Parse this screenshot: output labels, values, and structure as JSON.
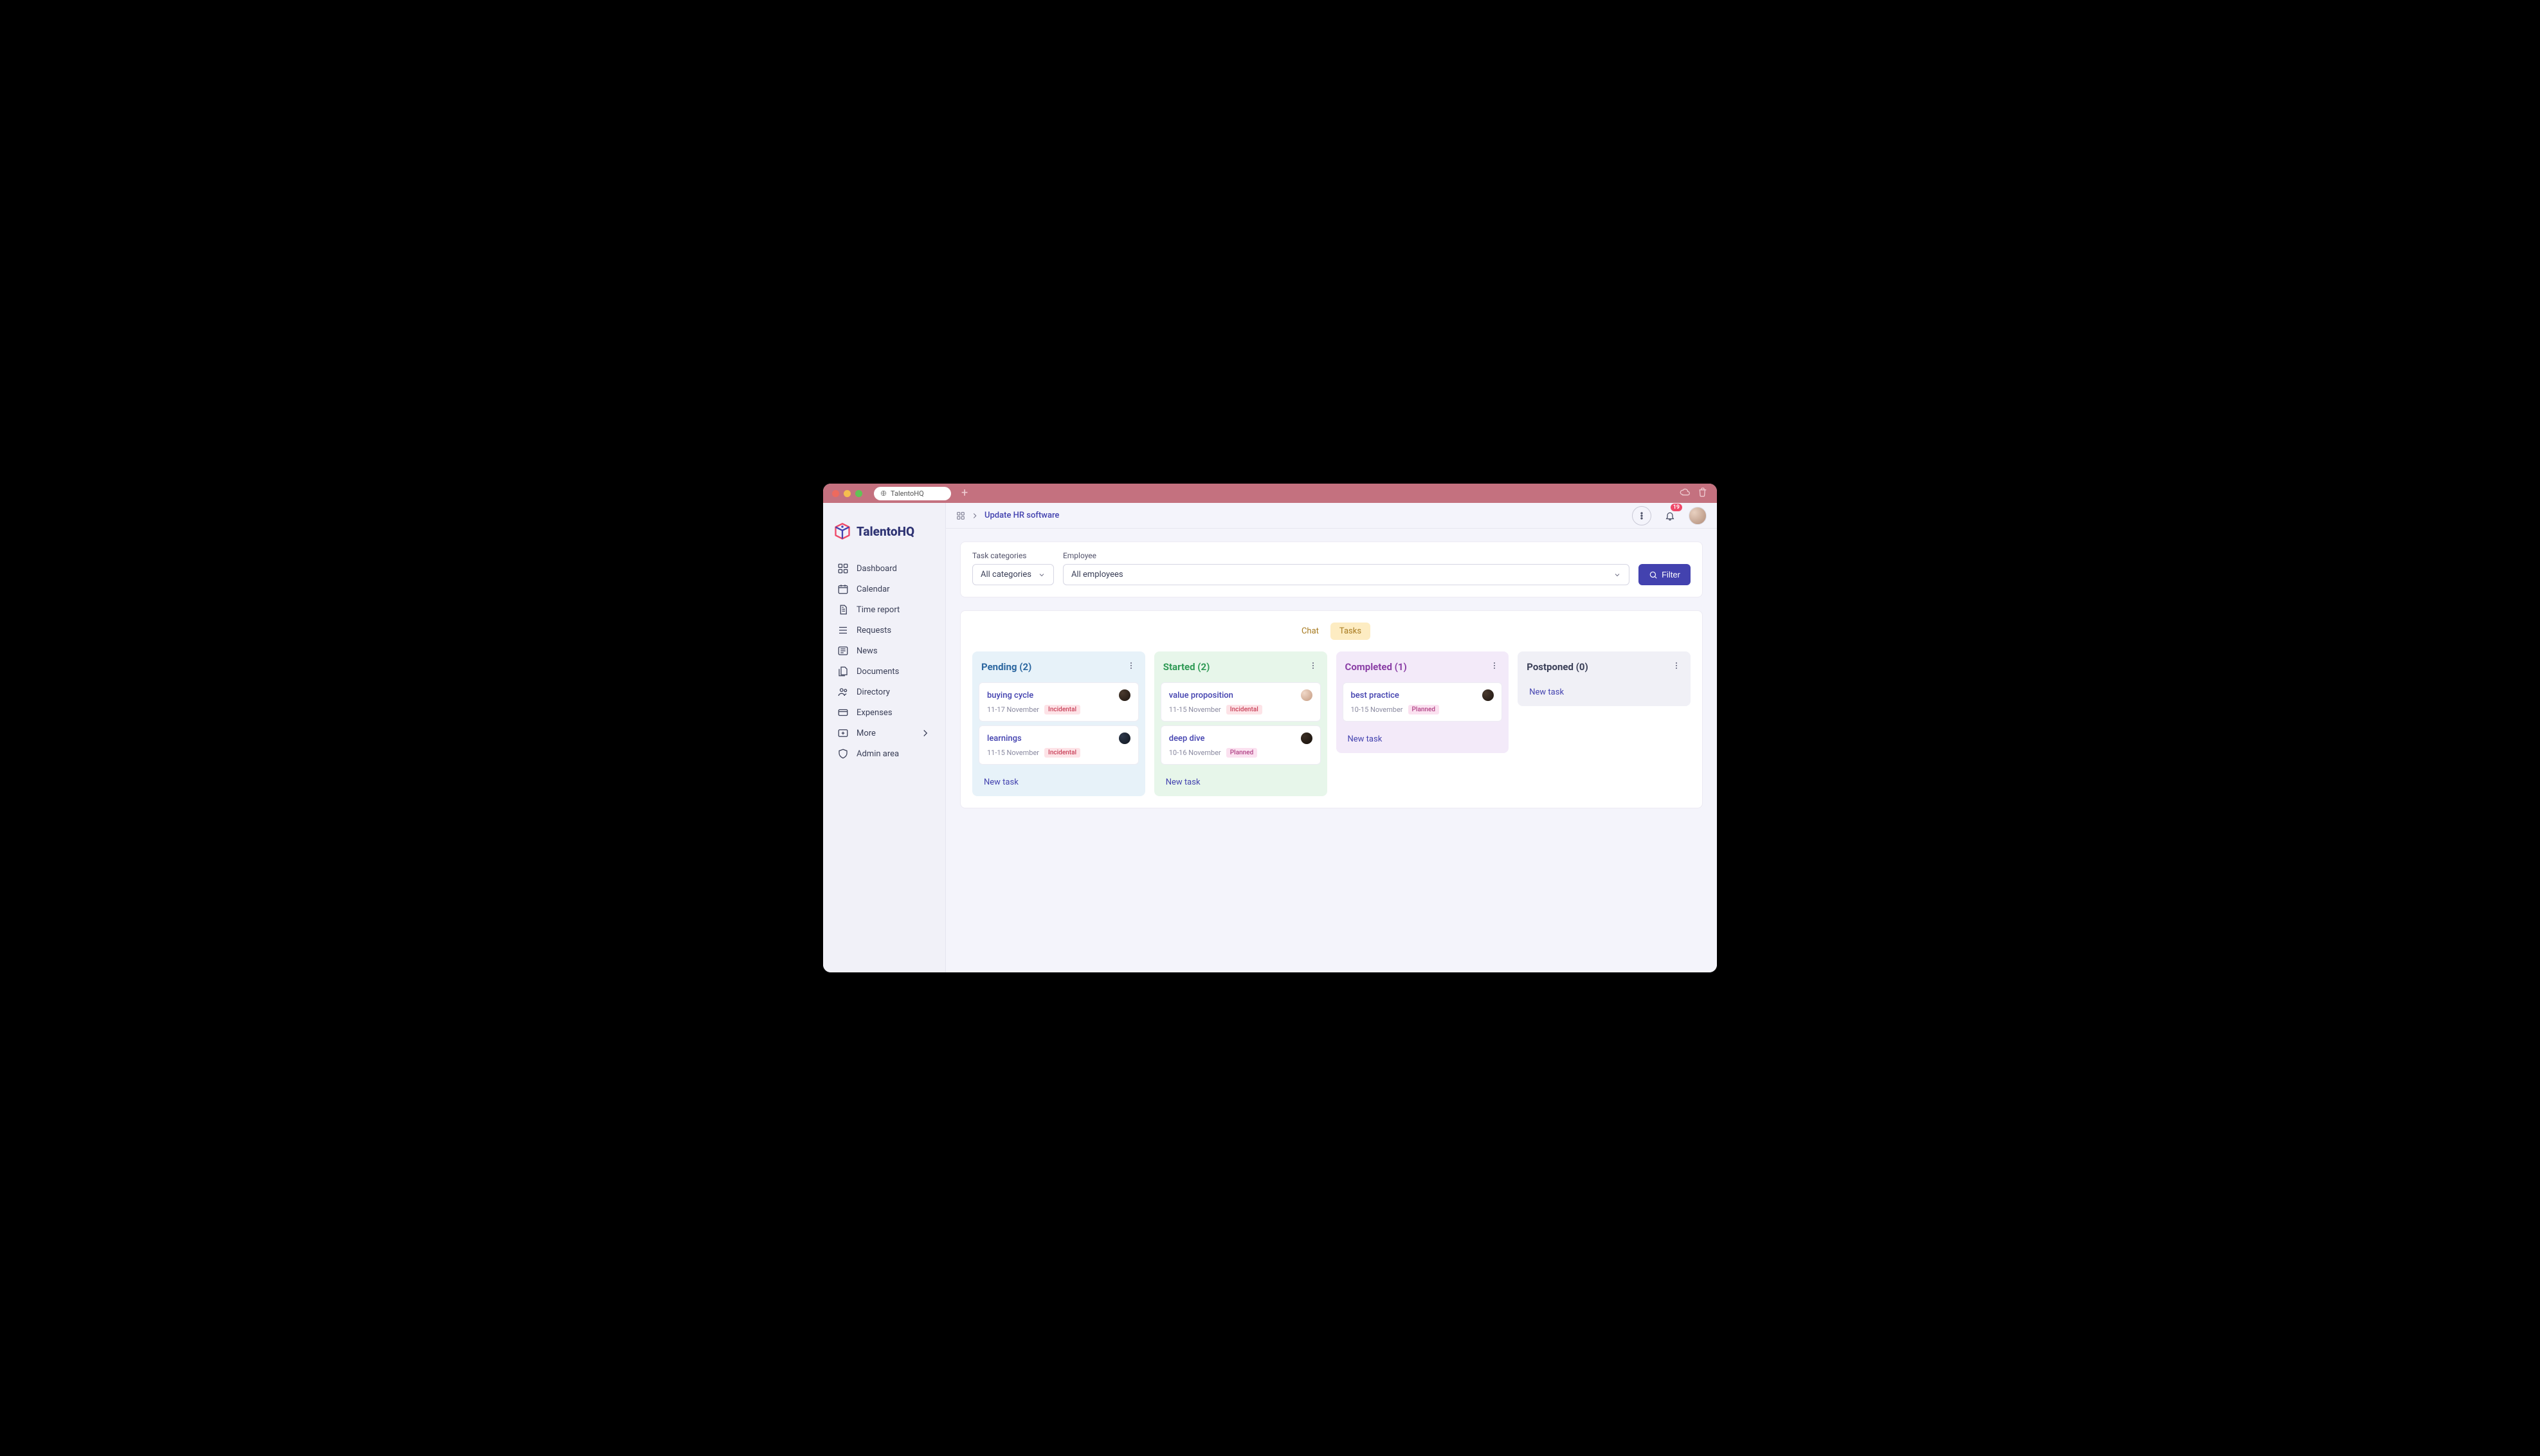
{
  "browser": {
    "tab_title": "TalentoHQ"
  },
  "brand": "TalentoHQ",
  "nav": {
    "dashboard": "Dashboard",
    "calendar": "Calendar",
    "time_report": "Time report",
    "requests": "Requests",
    "news": "News",
    "documents": "Documents",
    "directory": "Directory",
    "expenses": "Expenses",
    "more": "More",
    "admin": "Admin area"
  },
  "breadcrumb": {
    "current": "Update HR software"
  },
  "notifications": {
    "count": "19"
  },
  "filters": {
    "category_label": "Task categories",
    "category_value": "All categories",
    "employee_label": "Employee",
    "employee_value": "All employees",
    "button": "Filter"
  },
  "tabs": {
    "chat": "Chat",
    "tasks": "Tasks"
  },
  "board": {
    "pending": {
      "title": "Pending (2)"
    },
    "started": {
      "title": "Started (2)"
    },
    "completed": {
      "title": "Completed (1)"
    },
    "postponed": {
      "title": "Postponed (0)"
    },
    "new_task": "New task"
  },
  "cards": {
    "pending": [
      {
        "title": "buying cycle",
        "dates": "11-17 November",
        "tag": "Incidental"
      },
      {
        "title": "learnings",
        "dates": "11-15 November",
        "tag": "Incidental"
      }
    ],
    "started": [
      {
        "title": "value proposition",
        "dates": "11-15 November",
        "tag": "Incidental"
      },
      {
        "title": "deep dive",
        "dates": "10-16 November",
        "tag": "Planned"
      }
    ],
    "completed": [
      {
        "title": "best practice",
        "dates": "10-15 November",
        "tag": "Planned"
      }
    ]
  }
}
